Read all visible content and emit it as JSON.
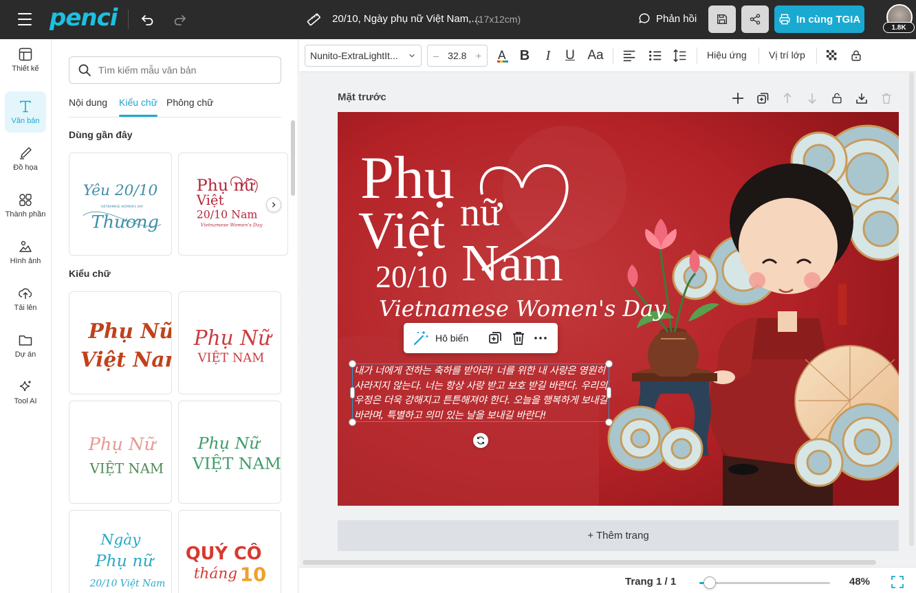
{
  "topbar": {
    "logo": "penci",
    "doc_title": "20/10, Ngày phụ nữ Việt Nam,...",
    "doc_size": "(17x12cm)",
    "feedback_label": "Phản hồi",
    "print_label": "In cùng TGIA",
    "avatar_badge": "1.8K"
  },
  "rail": {
    "items": [
      {
        "label": "Thiết kế",
        "icon": "layout-icon"
      },
      {
        "label": "Văn bản",
        "icon": "text-icon",
        "active": true
      },
      {
        "label": "Đồ họa",
        "icon": "pen-icon"
      },
      {
        "label": "Thành phần",
        "icon": "shapes-icon"
      },
      {
        "label": "Hình ảnh",
        "icon": "image-icon"
      },
      {
        "label": "Tải lên",
        "icon": "upload-icon"
      },
      {
        "label": "Dự án",
        "icon": "folder-icon"
      },
      {
        "label": "Tool AI",
        "icon": "sparkle-icon"
      }
    ]
  },
  "panel": {
    "search_placeholder": "Tìm kiếm mẫu văn bản",
    "tabs": [
      "Nội dung",
      "Kiểu chữ",
      "Phông chữ"
    ],
    "recent_title": "Dùng gần đây",
    "styles_title": "Kiểu chữ",
    "recent": [
      {
        "line1": "Yêu 20/10",
        "line2": "Thương",
        "sub": "VIETNAMESE WOMEN'S DAY"
      },
      {
        "line1": "Phụ nữ",
        "line2": "Việt",
        "line3": "20/10 Nam",
        "sub": "Vietnamese Women's Day"
      }
    ],
    "styles": [
      {
        "line1": "Phụ Nữ",
        "line2": "Việt Nam"
      },
      {
        "line1": "Phụ Nữ",
        "line2": "VIỆT NAM"
      },
      {
        "line1": "Phụ Nữ",
        "line2": "VIỆT NAM"
      },
      {
        "line1": "Phụ Nữ",
        "line2": "VIỆT NAM"
      },
      {
        "line1": "Ngày",
        "line2": "Phụ nữ",
        "line3": "20/10 Việt Nam"
      },
      {
        "line1": "QUÝ CÔ",
        "line2": "tháng",
        "line3": "10"
      }
    ]
  },
  "toolbar": {
    "font_name": "Nunito-ExtraLightIt...",
    "font_size": "32.8",
    "minus": "–",
    "plus": "+",
    "bold": "B",
    "italic": "I",
    "underline": "U",
    "case": "Aa",
    "effects": "Hiệu ứng",
    "layer_position": "Vị trí lớp"
  },
  "workspace": {
    "face_label": "Mặt trước",
    "add_page": "+ Thêm trang",
    "page_indicator": "Trang 1 / 1",
    "zoom": "48%",
    "zoom_fraction": 0.08
  },
  "canvas": {
    "title_phu": "Phụ",
    "title_nu": "nữ",
    "title_viet": "Việt",
    "title_nam": "Nam",
    "title_date": "20/10",
    "subtitle": "Vietnamese Women's Day",
    "body_text": "내가 너에게 전하는 축하를 받아라! 너를 위한 내 사랑은 영원히 사라지지 않는다. 너는 항상 사랑 받고 보호 받길 바란다. 우리의 우정은 더욱 강해지고 튼튼해져야 한다. 오늘을 행복하게 보내길 바라며, 특별하고 의미 있는 날을 보내길 바란다!",
    "context_menu": {
      "magic_label": "Hô biến"
    }
  }
}
